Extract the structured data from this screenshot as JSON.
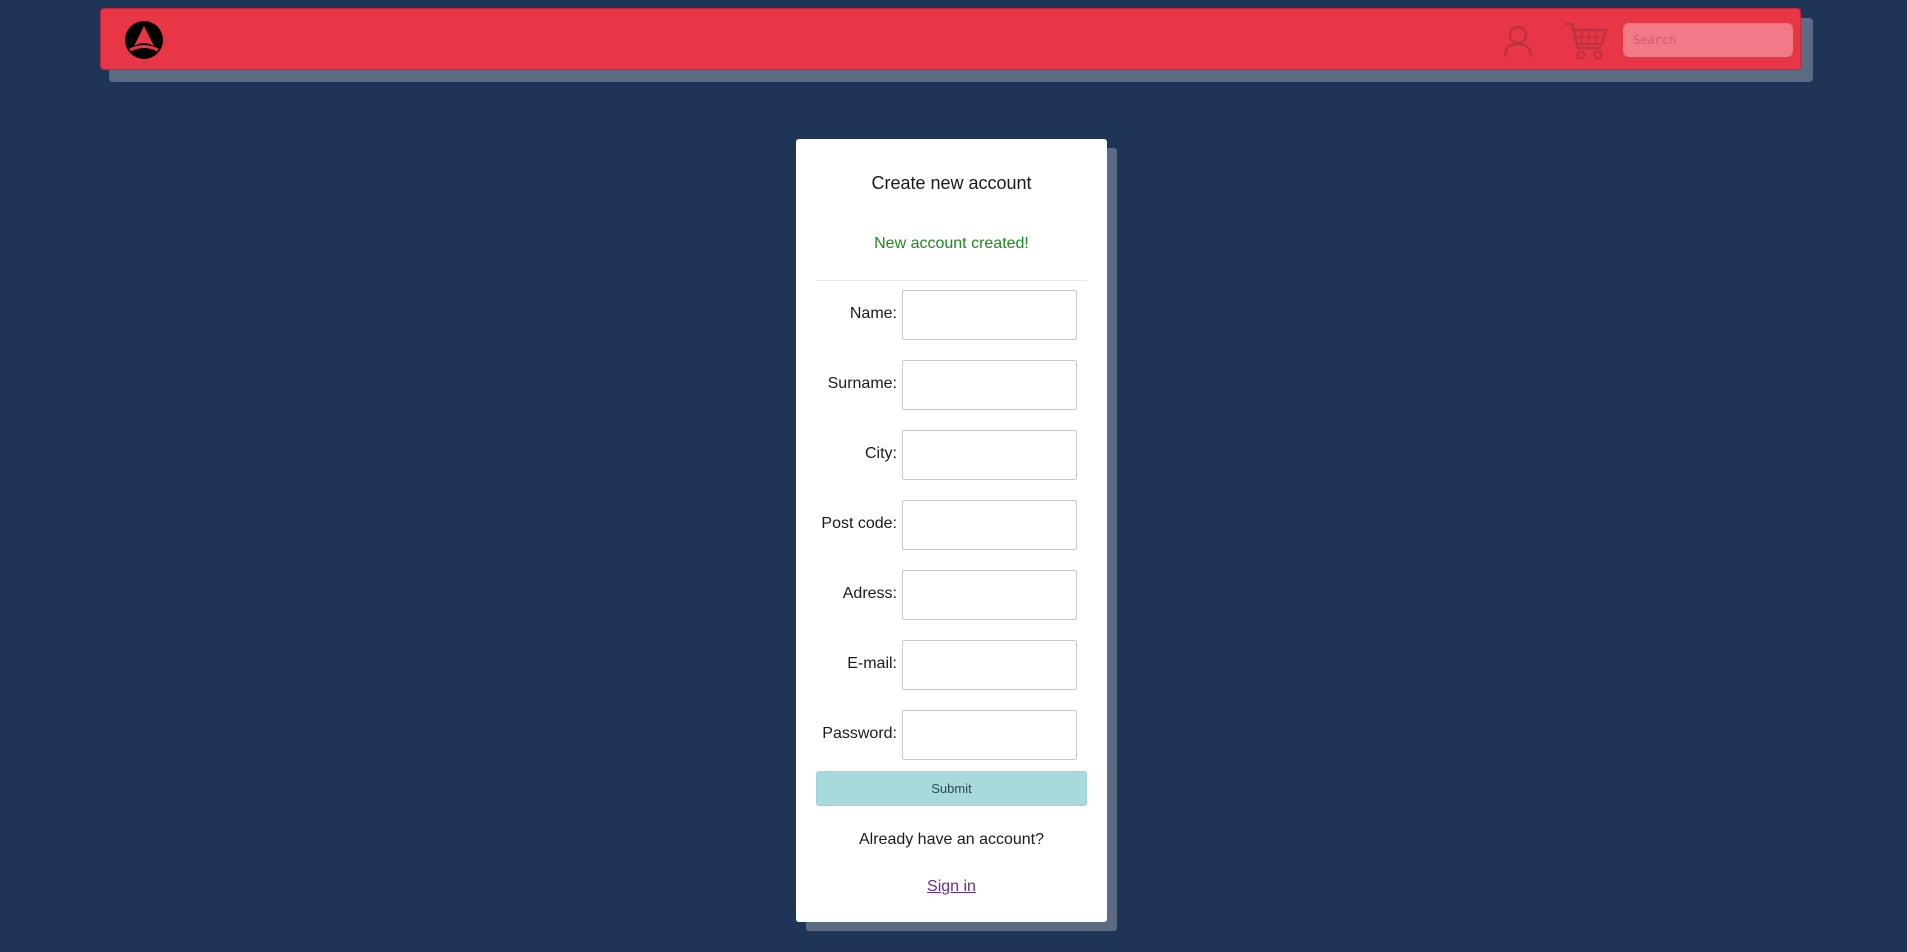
{
  "header": {
    "logo_icon": "logo-icon",
    "user_icon": "user-icon",
    "cart_icon": "cart-icon",
    "search_placeholder": "Search",
    "brand_color": "#e73646"
  },
  "form": {
    "title": "Create new account",
    "status_message": "New account created!",
    "status_color": "#1d8a1d",
    "fields": [
      {
        "label": "Name:",
        "value": ""
      },
      {
        "label": "Surname:",
        "value": ""
      },
      {
        "label": "City:",
        "value": ""
      },
      {
        "label": "Post code:",
        "value": ""
      },
      {
        "label": "Adress:",
        "value": ""
      },
      {
        "label": "E-mail:",
        "value": ""
      },
      {
        "label": "Password:",
        "value": ""
      }
    ],
    "submit_label": "Submit",
    "already_text": "Already have an account?",
    "signin_label": "Sign in"
  }
}
